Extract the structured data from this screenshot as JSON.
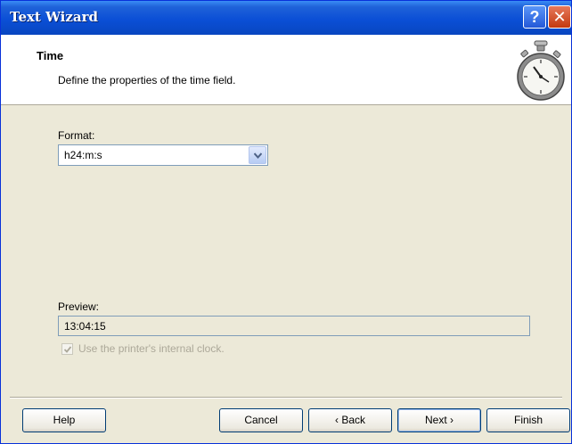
{
  "window": {
    "title": "Text Wizard",
    "help_glyph": "?",
    "close_glyph": "✕"
  },
  "header": {
    "title": "Time",
    "subtitle": "Define the properties of the time field.",
    "icon": "stopwatch-icon"
  },
  "format": {
    "label": "Format:",
    "value": "h24:m:s"
  },
  "preview": {
    "label": "Preview:",
    "value": "13:04:15"
  },
  "clock_option": {
    "label": "Use the printer's internal clock.",
    "checked": true,
    "disabled": true
  },
  "buttons": {
    "help": "Help",
    "cancel": "Cancel",
    "back": "‹ Back",
    "next": "Next ›",
    "finish": "Finish"
  },
  "colors": {
    "titlebar": "#0b4fd6",
    "dialog_bg": "#ece9d8",
    "disabled_text": "#aca899"
  }
}
